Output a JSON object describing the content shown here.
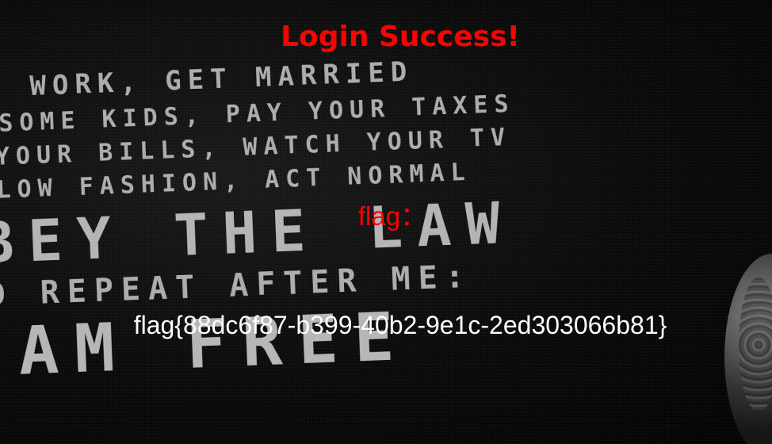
{
  "heading": "Login Success!",
  "flag_label": "flag：",
  "flag_value": "flag{88dc6f87-b399-40b2-9e1c-2ed303066b81}",
  "poster": {
    "lines": [
      "O WORK, GET MARRIED",
      "SOME KIDS, PAY YOUR TAXES",
      "YOUR BILLS, WATCH YOUR TV",
      "LOW FASHION, ACT NORMAL",
      "BEY THE LAW",
      "D REPEAT AFTER ME:",
      "AM FREE"
    ]
  },
  "colors": {
    "heading": "#ff0000",
    "flag_label": "#ff0000",
    "flag_value": "#ffffff",
    "background": "#050505"
  }
}
